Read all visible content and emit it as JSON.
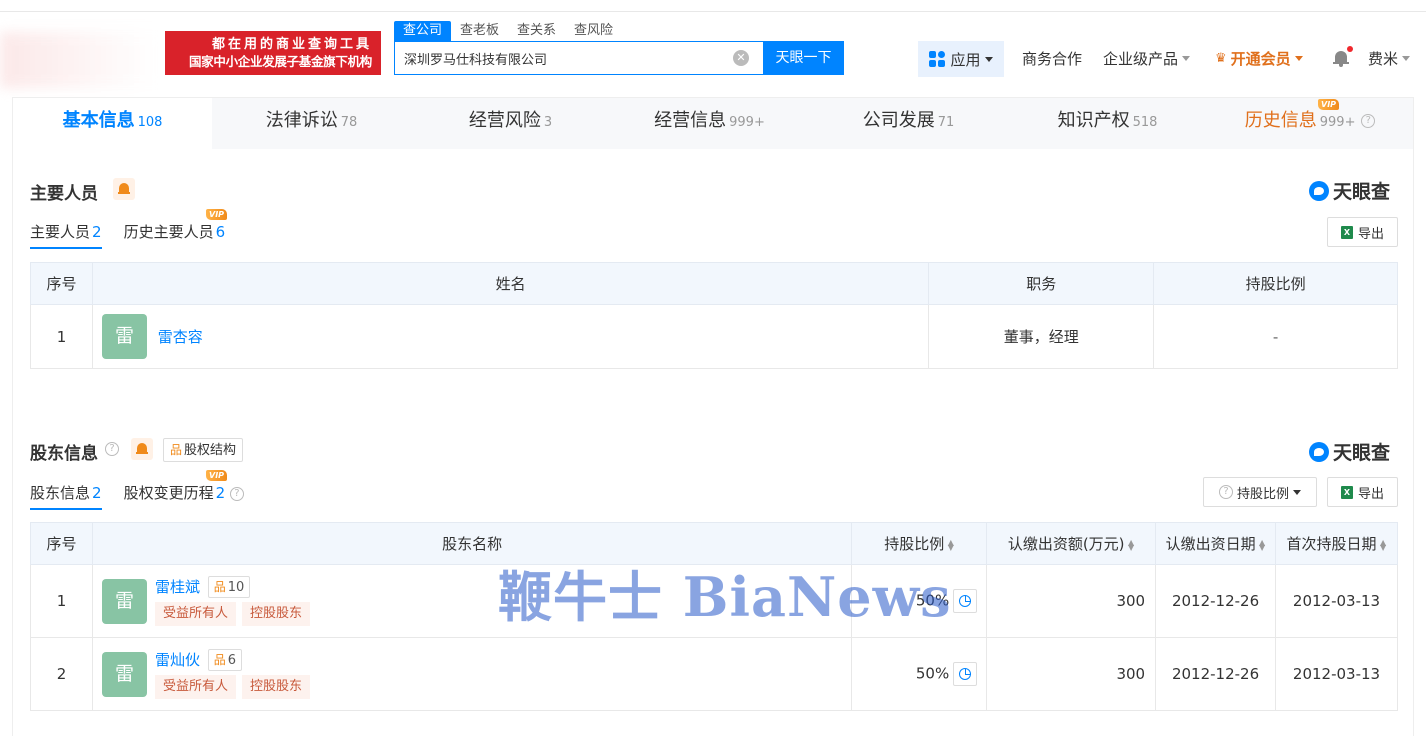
{
  "header": {
    "slogan_line1": "都在用的商业查询工具",
    "slogan_line2": "国家中小企业发展子基金旗下机构",
    "search_tabs": [
      "查公司",
      "查老板",
      "查关系",
      "查风险"
    ],
    "search_value": "深圳罗马仕科技有限公司",
    "search_button": "天眼一下",
    "nav": {
      "app": "应用",
      "business": "商务合作",
      "enterprise": "企业级产品",
      "vip": "开通会员",
      "user": "费米"
    }
  },
  "tabs": [
    {
      "label": "基本信息",
      "count": "108"
    },
    {
      "label": "法律诉讼",
      "count": "78"
    },
    {
      "label": "经营风险",
      "count": "3"
    },
    {
      "label": "经营信息",
      "count": "999+"
    },
    {
      "label": "公司发展",
      "count": "71"
    },
    {
      "label": "知识产权",
      "count": "518"
    },
    {
      "label": "历史信息",
      "count": "999+"
    }
  ],
  "vip_label": "VIP",
  "brand": "天眼查",
  "export_label": "导出",
  "personnel": {
    "title": "主要人员",
    "subtabs": [
      {
        "label": "主要人员",
        "count": "2"
      },
      {
        "label": "历史主要人员",
        "count": "6"
      }
    ],
    "columns": [
      "序号",
      "姓名",
      "职务",
      "持股比例"
    ],
    "rows": [
      {
        "index": "1",
        "avatar": "雷",
        "name": "雷杏容",
        "position": "董事，经理",
        "share": "-"
      }
    ]
  },
  "shareholders": {
    "title": "股东信息",
    "equity_button": "股权结构",
    "share_ratio_button": "持股比例",
    "subtabs": [
      {
        "label": "股东信息",
        "count": "2"
      },
      {
        "label": "股权变更历程",
        "count": "2"
      }
    ],
    "columns": [
      "序号",
      "股东名称",
      "持股比例",
      "认缴出资额(万元)",
      "认缴出资日期",
      "首次持股日期"
    ],
    "rows": [
      {
        "index": "1",
        "avatar": "雷",
        "name": "雷桂斌",
        "related": "10",
        "tags": [
          "受益所有人",
          "控股股东"
        ],
        "share": "50%",
        "amount": "300",
        "subscribe_date": "2012-12-26",
        "first_date": "2012-03-13"
      },
      {
        "index": "2",
        "avatar": "雷",
        "name": "雷灿伙",
        "related": "6",
        "tags": [
          "受益所有人",
          "控股股东"
        ],
        "share": "50%",
        "amount": "300",
        "subscribe_date": "2012-12-26",
        "first_date": "2012-03-13"
      }
    ]
  },
  "watermark": "鞭牛士 BiaNews",
  "colors": {
    "accent": "#0084ff",
    "slogan_bg": "#d9222a",
    "vip": "#e0701c",
    "avatar": "#88c4a4"
  }
}
